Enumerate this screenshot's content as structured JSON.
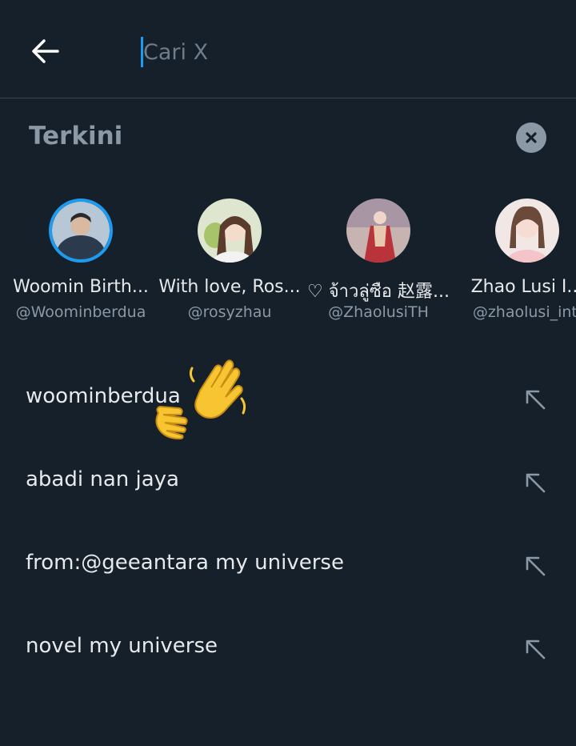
{
  "search": {
    "placeholder": "Cari X",
    "value": ""
  },
  "recent": {
    "title": "Terkini",
    "clear_icon": "close-icon"
  },
  "accounts": [
    {
      "name": "Woomin Birth...",
      "handle": "@Woominberdua",
      "avatar_color": "#6b7d92",
      "ring": true
    },
    {
      "name": "With love, Ros...",
      "handle": "@rosyzhau",
      "avatar_color": "#c9d6a8",
      "ring": false
    },
    {
      "name": "♡ จ้าวลู่ซือ 赵露...",
      "handle": "@ZhaolusiTH",
      "avatar_color": "#c98a8f",
      "ring": false
    },
    {
      "name": "Zhao Lusi I...",
      "handle": "@zhaolusi_intl",
      "avatar_color": "#e8d6d0",
      "ring": false
    }
  ],
  "queries": [
    {
      "text": "woominberdua",
      "icon": "arrow-up-left-icon"
    },
    {
      "text": "abadi nan jaya",
      "icon": "arrow-up-left-icon"
    },
    {
      "text": "from:@geeantara my universe",
      "icon": "arrow-up-left-icon"
    },
    {
      "text": "novel my universe",
      "icon": "arrow-up-left-icon"
    }
  ],
  "colors": {
    "background": "#15202b",
    "accent": "#1d9bf0",
    "text_primary": "#e7e9ea",
    "text_secondary": "#8b98a5"
  }
}
